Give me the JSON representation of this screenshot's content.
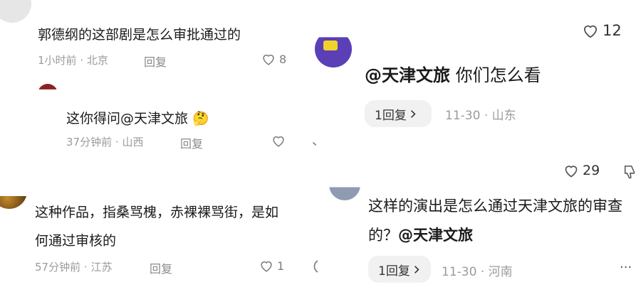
{
  "left": {
    "c1": {
      "text": "郭德纲的这部剧是怎么审批通过的",
      "time": "1小时前",
      "location": "北京",
      "reply_label": "回复",
      "likes": "8"
    },
    "c2": {
      "text": "这你得问",
      "mention": "@天津文旅",
      "emoji": "🤔",
      "time": "37分钟前",
      "location": "山西",
      "reply_label": "回复",
      "trail_mark": "、"
    },
    "c3": {
      "line1": "这种作品，指桑骂槐，赤裸裸骂街，是如",
      "line2": "何通过审核的",
      "time": "57分钟前",
      "location": "江苏",
      "reply_label": "回复",
      "likes": "1"
    },
    "sep": "·"
  },
  "right": {
    "top_likes": "12",
    "c1": {
      "mention": "@天津文旅",
      "text": " 你们怎么看",
      "reply_count": "1回复",
      "date": "11-30",
      "location": "山东",
      "likes": "29"
    },
    "c2": {
      "line1": "这样的演出是怎么通过天津文旅的审查",
      "line2_prefix": "的？",
      "mention": "@天津文旅",
      "reply_count": "1回复",
      "date": "11-30",
      "location": "河南",
      "more": "···"
    },
    "sep": "·"
  },
  "colors": {
    "text": "#1a1a1a",
    "meta": "#9b9b9b",
    "pill": "#f1f1f1"
  },
  "icons": [
    "heart-outline-icon",
    "thumbs-down-icon",
    "chevron-right-icon",
    "more-icon"
  ]
}
